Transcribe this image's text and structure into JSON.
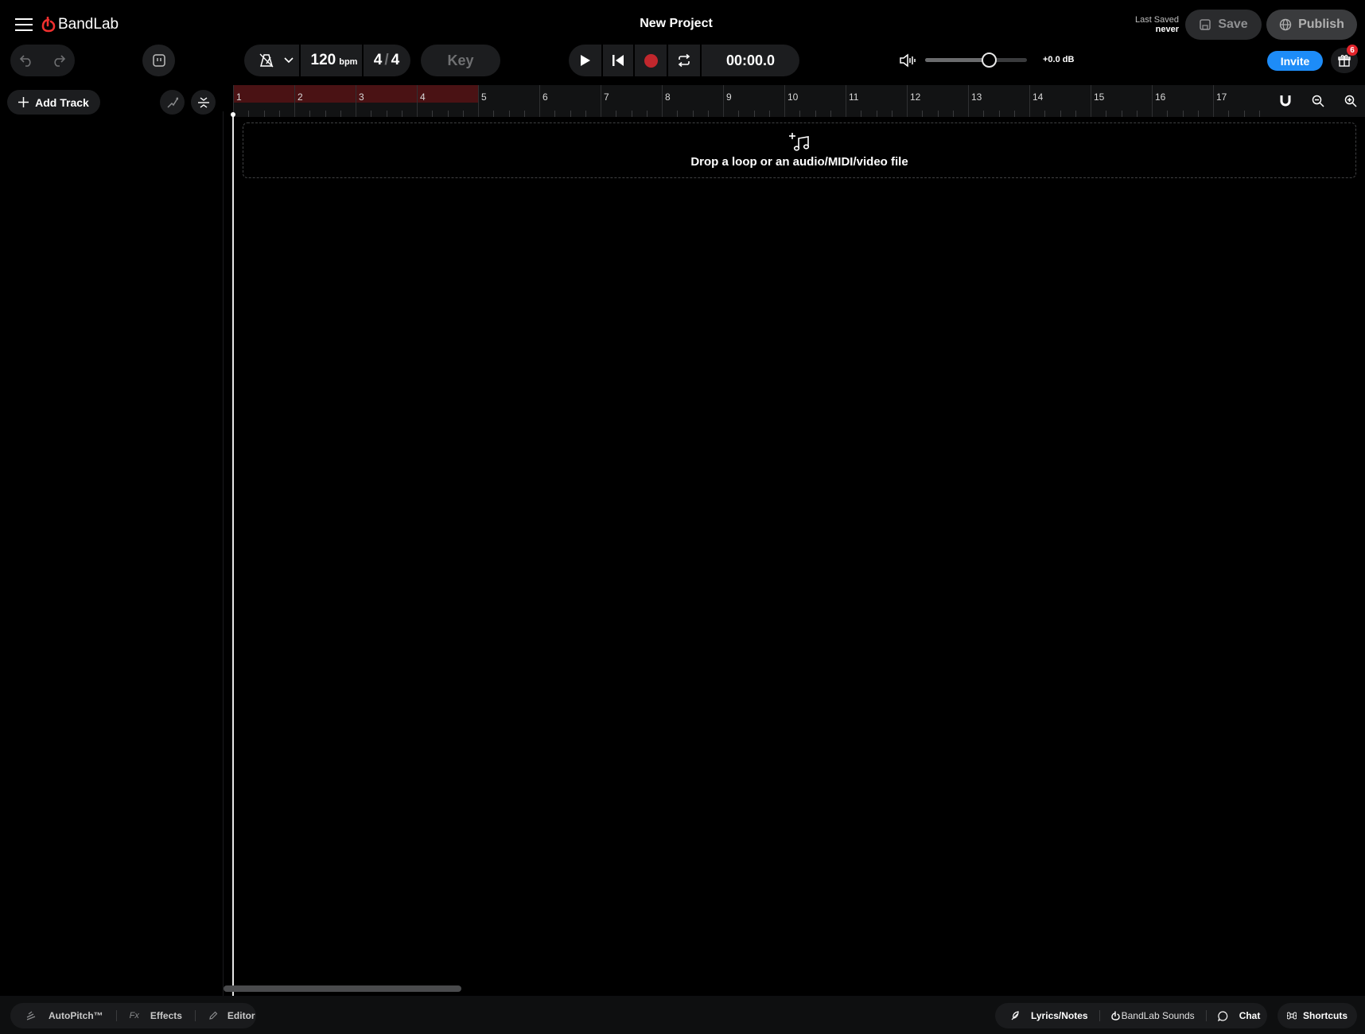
{
  "app": {
    "name": "BandLab",
    "project_title": "New Project"
  },
  "save_status": {
    "label": "Last Saved",
    "value": "never"
  },
  "buttons": {
    "save": "Save",
    "publish": "Publish",
    "invite": "Invite",
    "add_track": "Add Track",
    "key": "Key"
  },
  "gift": {
    "badge_count": "6"
  },
  "transport": {
    "bpm": "120",
    "bpm_unit": "bpm",
    "time_sig_num": "4",
    "time_sig_sep": "/",
    "time_sig_den": "4",
    "time": "00:00.0"
  },
  "volume": {
    "db": "+0.0 dB",
    "level": 0.63
  },
  "ruler": {
    "bars": [
      "1",
      "2",
      "3",
      "4",
      "5",
      "6",
      "7",
      "8",
      "9",
      "10",
      "11",
      "12",
      "13",
      "14",
      "15",
      "16",
      "17"
    ],
    "loop_end_bar": 5
  },
  "drop_zone": {
    "text": "Drop a loop or an audio/MIDI/video file"
  },
  "bottom_left": [
    {
      "label": "AutoPitch™",
      "icon": "autopitch-icon"
    },
    {
      "label": "Effects",
      "icon": "fx-icon",
      "prefix": "Fx"
    },
    {
      "label": "Editor",
      "icon": "pencil-icon"
    }
  ],
  "bottom_right": {
    "lyrics": "Lyrics/Notes",
    "sounds": "BandLab Sounds",
    "chat": "Chat",
    "shortcuts": "Shortcuts"
  },
  "colors": {
    "accent_blue": "#1d8cf8",
    "record_red": "#c1272d",
    "loop_region": "#4a1214",
    "badge_red": "#e3242b",
    "logo_red": "#f0302f"
  }
}
